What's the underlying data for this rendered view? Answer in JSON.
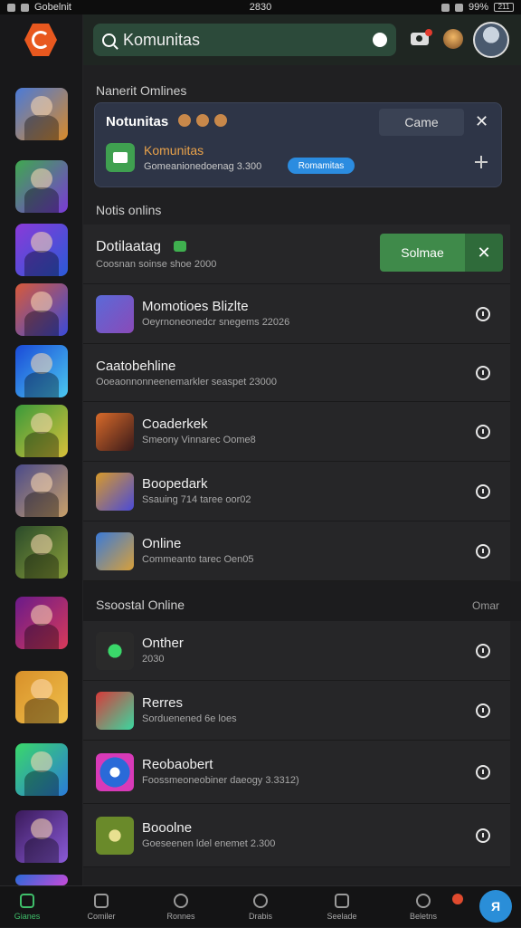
{
  "status": {
    "app_label": "Gobelnit",
    "time": "2830",
    "battery_pct": "99%",
    "battery_box": "211"
  },
  "search": {
    "label": "Komunitas"
  },
  "section1": {
    "label": "Nanerit Omlines"
  },
  "card": {
    "title": "Notunitas",
    "button": "Came",
    "app_name": "Komunitas",
    "sub": "Gomeanionedoenag 3.300",
    "pill": "Romamitas"
  },
  "section2": {
    "label": "Notis onlins"
  },
  "featured": {
    "name": "Dotilaatag",
    "sub": "Coosnan soinse shoe 2000",
    "button": "Solmae"
  },
  "list1": [
    {
      "name": "Momotioes Blizlte",
      "sub": "Oeyrnoneonedcr snegems 22026"
    },
    {
      "name": "Caatobehline",
      "sub": "Ooeaonnonneenemarkler seaspet 23000"
    },
    {
      "name": "Coaderkek",
      "sub": "Smeony Vinnarec Oome8"
    },
    {
      "name": "Boopedark",
      "sub": "Ssauing 714 taree oor02"
    },
    {
      "name": "Online",
      "sub": "Commeanto tarec Oen05"
    }
  ],
  "section3": {
    "label": "Ssoostal Online",
    "right": "Omar"
  },
  "list2": [
    {
      "name": "Onther",
      "sub": "2030"
    },
    {
      "name": "Rerres",
      "sub": "Sorduenened 6e loes"
    },
    {
      "name": "Reobaobert",
      "sub": "Foossmeoneobiner daeogy 3.3312)"
    },
    {
      "name": "Booolne",
      "sub": "Goeseenen ldel enemet 2.300"
    }
  ],
  "tabs": [
    "Gianes",
    "Comiler",
    "Ronnes",
    "Drabis",
    "Seelade",
    "Beletns"
  ],
  "help_label": "Я",
  "colors": {
    "accent": "#3f8a4a",
    "brand": "#e8581f",
    "pill": "#2b8ce0"
  }
}
